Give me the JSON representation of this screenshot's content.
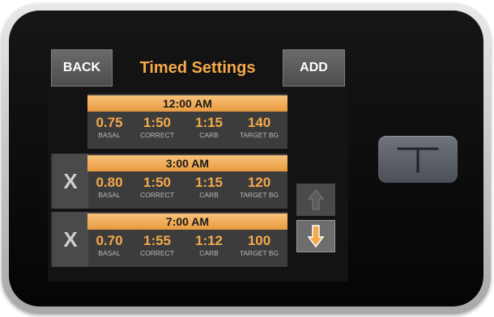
{
  "header": {
    "back_label": "BACK",
    "title": "Timed Settings",
    "add_label": "ADD"
  },
  "rows": [
    {
      "time": "12:00 AM",
      "values": [
        {
          "value": "0.75",
          "label": "BASAL"
        },
        {
          "value": "1:50",
          "label": "CORRECT"
        },
        {
          "value": "1:15",
          "label": "CARB"
        },
        {
          "value": "140",
          "label": "TARGET BG"
        }
      ]
    },
    {
      "time": "3:00 AM",
      "delete_label": "X",
      "values": [
        {
          "value": "0.80",
          "label": "BASAL"
        },
        {
          "value": "1:50",
          "label": "CORRECT"
        },
        {
          "value": "1:15",
          "label": "CARB"
        },
        {
          "value": "120",
          "label": "TARGET BG"
        }
      ]
    },
    {
      "time": "7:00 AM",
      "delete_label": "X",
      "values": [
        {
          "value": "0.70",
          "label": "BASAL"
        },
        {
          "value": "1:55",
          "label": "CORRECT"
        },
        {
          "value": "1:12",
          "label": "CARB"
        },
        {
          "value": "100",
          "label": "TARGET BG"
        }
      ]
    }
  ],
  "icons": {
    "scroll_up": "arrow-up-icon",
    "scroll_down": "arrow-down-icon",
    "home_button": "t-logo-icon"
  },
  "colors": {
    "accent_orange": "#f5a94a",
    "header_orange": "#e89a3f",
    "screen_bg": "#131313",
    "cell_bg": "#3c3c3c"
  }
}
